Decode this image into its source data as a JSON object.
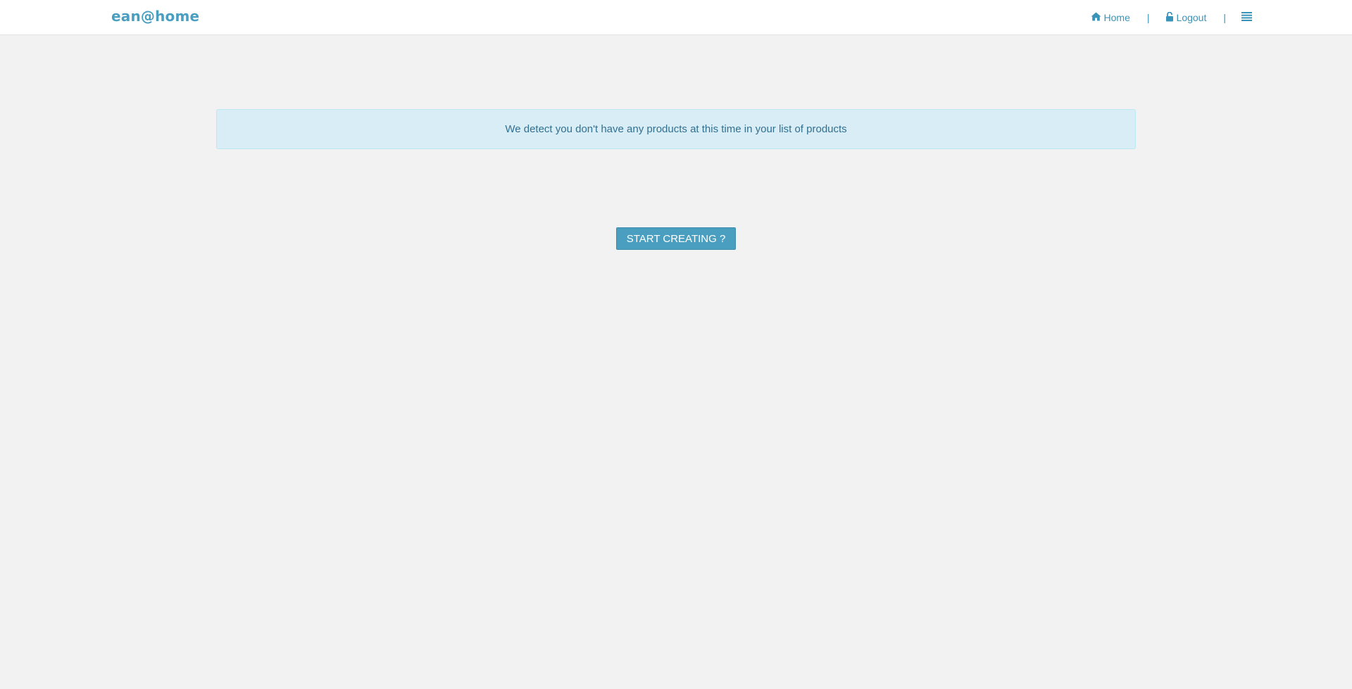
{
  "header": {
    "brand": "ean@home",
    "nav": {
      "home_label": "Home",
      "home_icon": "home-icon",
      "logout_label": "Logout",
      "logout_icon": "unlock-icon",
      "separator": "|",
      "menu_icon": "hamburger-menu-icon"
    }
  },
  "main": {
    "alert_text": "We detect you don't have any products at this time in your list of products",
    "start_button_label": "START CREATING ?"
  },
  "colors": {
    "page_background": "#f2f2f2",
    "accent": "#4a9fc0",
    "alert_background": "#d9edf7",
    "alert_border": "#bce8f1",
    "alert_text": "#31708f"
  }
}
